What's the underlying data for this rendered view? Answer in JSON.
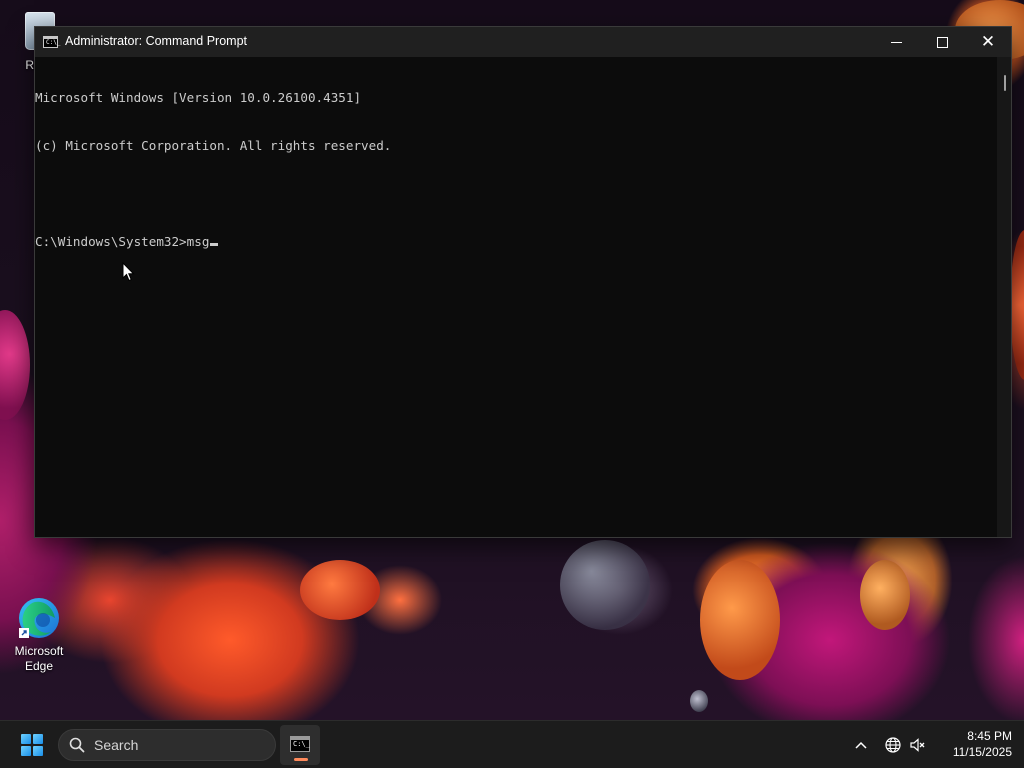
{
  "window": {
    "title": "Administrator: Command Prompt",
    "icon": "cmd-icon",
    "icon_glyph": "C:\\_"
  },
  "console": {
    "lines": [
      "Microsoft Windows [Version 10.0.26100.4351]",
      "(c) Microsoft Corporation. All rights reserved.",
      "",
      "C:\\Windows\\System32>msg"
    ],
    "prompt": "C:\\Windows\\System32>",
    "typed": "msg"
  },
  "desktop": {
    "icons": [
      {
        "label": "Recy",
        "icon": "recycle-bin-icon"
      },
      {
        "label": "Microsoft Edge",
        "icon": "edge-icon"
      }
    ]
  },
  "taskbar": {
    "search_label": "Search",
    "cmd_glyph": "C:\\_",
    "time": "8:45 PM",
    "date": "11/15/2025"
  },
  "colors": {
    "console_bg": "#0c0c0c",
    "console_text": "#cccccc",
    "titlebar_bg": "#202020",
    "taskbar_bg": "#1c1c1c",
    "active_indicator": "#ff8a5c"
  }
}
